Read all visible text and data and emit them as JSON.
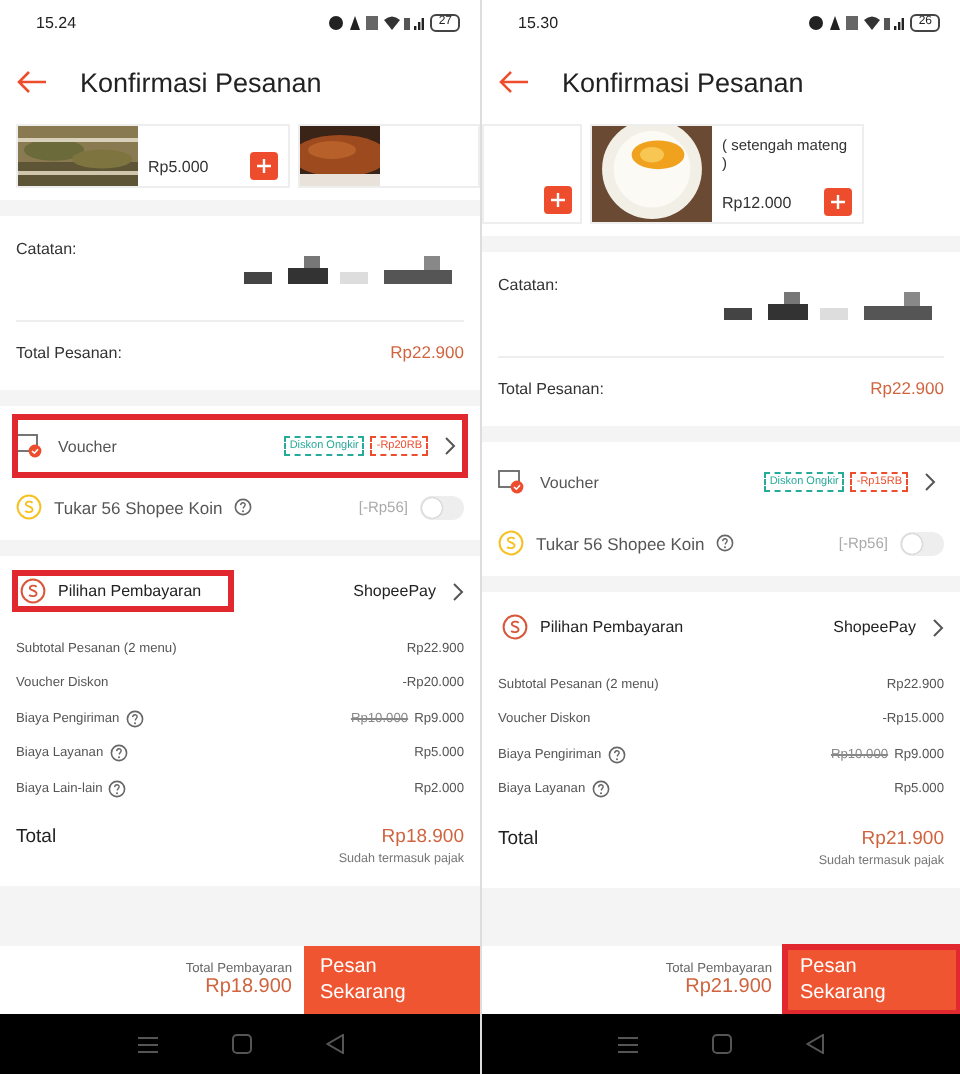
{
  "screens": [
    {
      "status_bar": {
        "time": "15.24",
        "battery": "27"
      },
      "header": {
        "title": "Konfirmasi Pesanan"
      },
      "items": [
        {
          "kind": "full",
          "price": "Rp5.000"
        },
        {
          "kind": "cut_right"
        }
      ],
      "note": {
        "label": "Catatan:",
        "redacted": true
      },
      "order_total": {
        "label": "Total Pesanan:",
        "value": "Rp22.900"
      },
      "voucher": {
        "label": "Voucher",
        "highlighted": true,
        "tags": [
          {
            "text": "Diskon Ongkir",
            "color": "#26aa99"
          },
          {
            "text": "-Rp20RB",
            "color": "#ee4d2d"
          }
        ]
      },
      "coins": {
        "label": "Tukar 56 Shopee Koin",
        "value": "[-Rp56]",
        "on": false
      },
      "payment": {
        "label": "Pilihan Pembayaran",
        "value": "ShopeePay",
        "highlighted": true
      },
      "fees": [
        {
          "label": "Subtotal Pesanan (2 menu)",
          "info": false,
          "value": "Rp22.900"
        },
        {
          "label": "Voucher Diskon",
          "info": false,
          "value": "-Rp20.000"
        },
        {
          "label": "Biaya Pengiriman",
          "info": true,
          "old_value": "Rp10.000",
          "value": "Rp9.000"
        },
        {
          "label": "Biaya Layanan",
          "info": true,
          "value": "Rp5.000"
        },
        {
          "label": "Biaya Lain-lain",
          "info": true,
          "value": "Rp2.000"
        }
      ],
      "total": {
        "label": "Total",
        "value": "Rp18.900",
        "note": "Sudah termasuk pajak"
      },
      "footer": {
        "label": "Total Pembayaran",
        "value": "Rp18.900",
        "button": "Pesan Sekarang",
        "highlighted": false
      }
    },
    {
      "status_bar": {
        "time": "15.30",
        "battery": "26"
      },
      "header": {
        "title": "Konfirmasi Pesanan"
      },
      "items": [
        {
          "kind": "cut_left"
        },
        {
          "kind": "full",
          "name": "( setengah mateng )",
          "price": "Rp12.000"
        }
      ],
      "note": {
        "label": "Catatan:",
        "redacted": true
      },
      "order_total": {
        "label": "Total Pesanan:",
        "value": "Rp22.900"
      },
      "voucher": {
        "label": "Voucher",
        "highlighted": false,
        "tags": [
          {
            "text": "Diskon Ongkir",
            "color": "#26aa99"
          },
          {
            "text": "-Rp15RB",
            "color": "#ee4d2d"
          }
        ]
      },
      "coins": {
        "label": "Tukar 56 Shopee Koin",
        "value": "[-Rp56]",
        "on": false
      },
      "payment": {
        "label": "Pilihan Pembayaran",
        "value": "ShopeePay",
        "highlighted": false
      },
      "fees": [
        {
          "label": "Subtotal Pesanan (2 menu)",
          "info": false,
          "value": "Rp22.900"
        },
        {
          "label": "Voucher Diskon",
          "info": false,
          "value": "-Rp15.000"
        },
        {
          "label": "Biaya Pengiriman",
          "info": true,
          "old_value": "Rp10.000",
          "value": "Rp9.000"
        },
        {
          "label": "Biaya Layanan",
          "info": true,
          "value": "Rp5.000"
        }
      ],
      "total": {
        "label": "Total",
        "value": "Rp21.900",
        "note": "Sudah termasuk pajak"
      },
      "footer": {
        "label": "Total Pembayaran",
        "value": "Rp21.900",
        "button": "Pesan Sekarang",
        "highlighted": true
      }
    }
  ]
}
